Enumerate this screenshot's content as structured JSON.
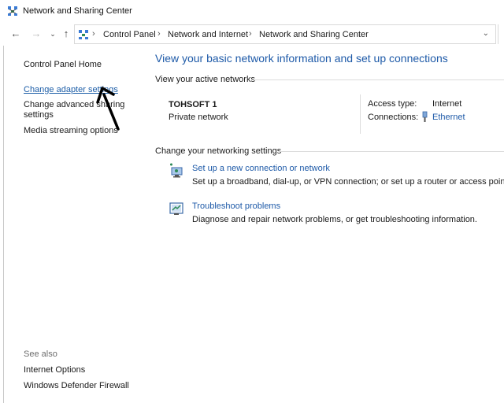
{
  "window": {
    "title": "Network and Sharing Center"
  },
  "nav": {
    "back_icon": "back-arrow-icon",
    "forward_icon": "forward-arrow-icon",
    "recent_icon": "chevron-down-icon",
    "up_icon": "up-arrow-icon",
    "breadcrumb": [
      "Control Panel",
      "Network and Internet",
      "Network and Sharing Center"
    ]
  },
  "sidebar": {
    "home": "Control Panel Home",
    "items": [
      "Change adapter settings",
      "Change advanced sharing",
      "settings",
      "Media streaming options"
    ],
    "see_also_label": "See also",
    "see_also": [
      "Internet Options",
      "Windows Defender Firewall"
    ]
  },
  "main": {
    "title": "View your basic network information and set up connections",
    "active_networks_label": "View your active networks",
    "network": {
      "name": "TOHSOFT 1",
      "type": "Private network",
      "access_type_label": "Access type:",
      "access_type_value": "Internet",
      "connections_label": "Connections:",
      "connections_value": "Ethernet"
    },
    "change_settings_label": "Change your networking settings",
    "tasks": [
      {
        "title": "Set up a new connection or network",
        "desc": "Set up a broadband, dial-up, or VPN connection; or set up a router or access point.",
        "icon": "new-connection-icon"
      },
      {
        "title": "Troubleshoot problems",
        "desc": "Diagnose and repair network problems, or get troubleshooting information.",
        "icon": "troubleshoot-icon"
      }
    ]
  },
  "colors": {
    "link": "#1e5aa8",
    "text": "#1a1a1a",
    "muted": "#6d6d6d"
  }
}
